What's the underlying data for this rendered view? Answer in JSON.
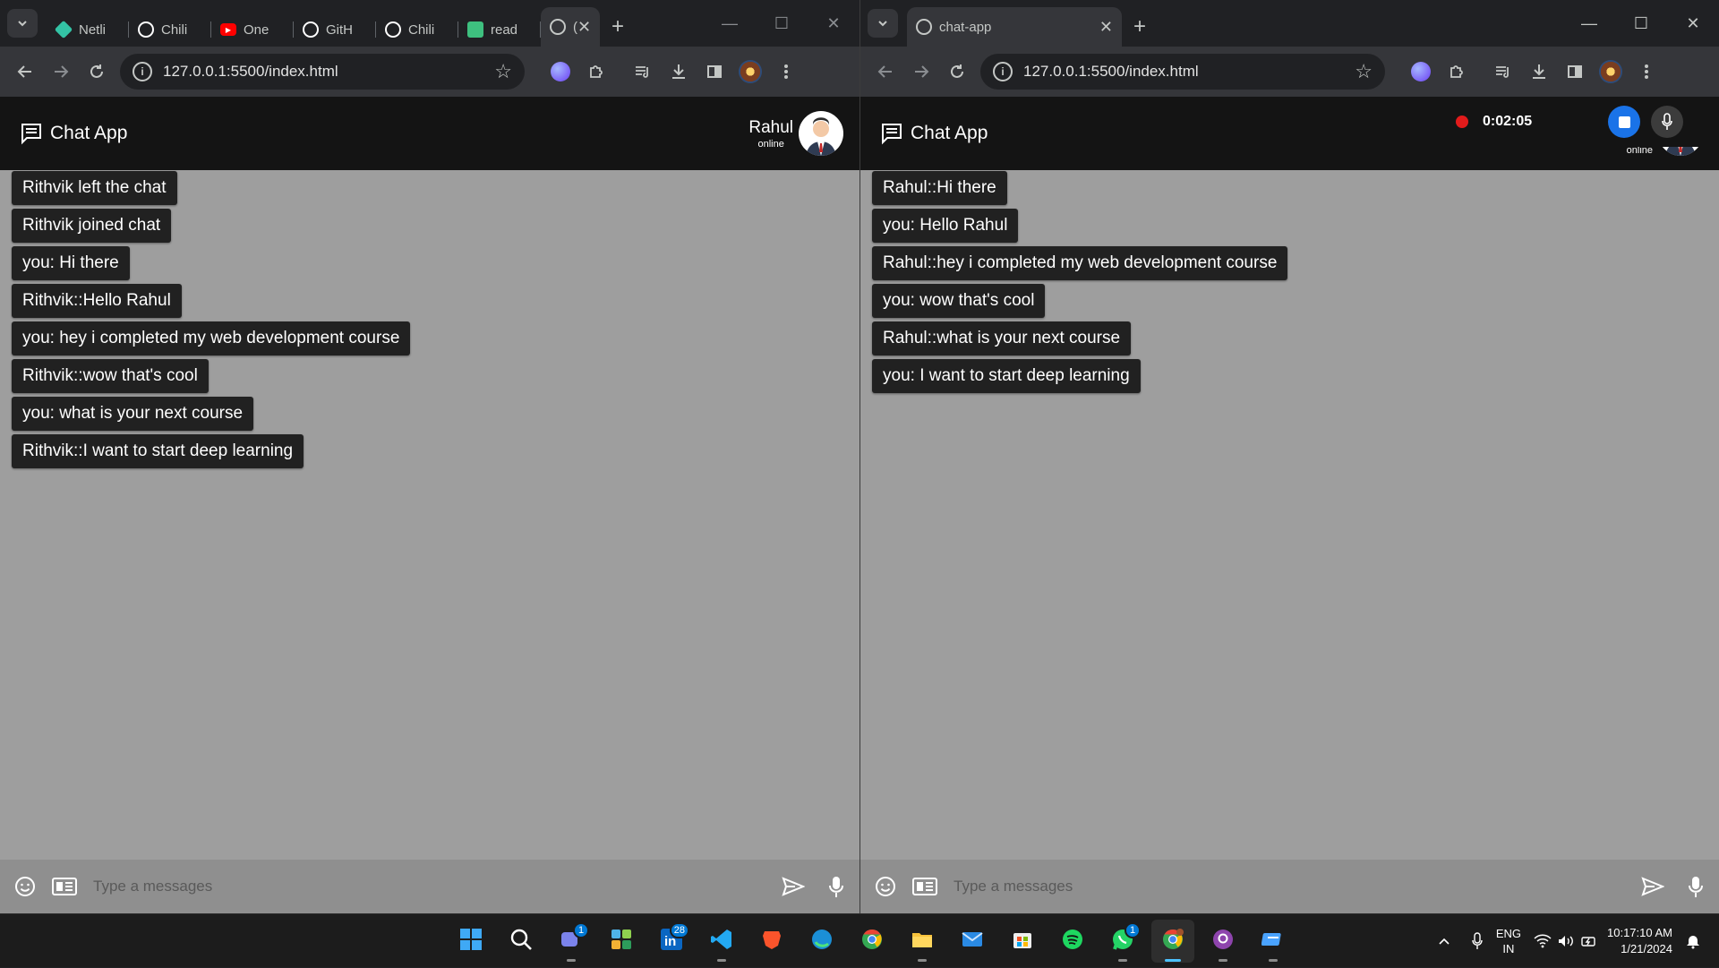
{
  "left": {
    "tabs": [
      {
        "label": "Netli",
        "icon": "netlify-icon",
        "color": "#33c3a5"
      },
      {
        "label": "Chili",
        "icon": "github-icon",
        "color": "#ffffff"
      },
      {
        "label": "One",
        "icon": "youtube-icon",
        "color": "#ff0000"
      },
      {
        "label": "GitH",
        "icon": "github-icon",
        "color": "#ffffff"
      },
      {
        "label": "Chili",
        "icon": "github-icon",
        "color": "#ffffff"
      },
      {
        "label": "read",
        "icon": "readme-icon",
        "color": "#3ec07f"
      },
      {
        "label": "(",
        "icon": "globe-icon",
        "color": "#c4c7c5",
        "active": true
      }
    ],
    "url": "127.0.0.1:5500/index.html",
    "app_title": "Chat App",
    "user_name": "Rahul",
    "user_status": "online",
    "messages": [
      "Rithvik left the chat",
      "Rithvik joined chat",
      "you: Hi there",
      "Rithvik::Hello Rahul",
      "you: hey i completed my web development course",
      "Rithvik::wow that's cool",
      "you: what is your next course",
      "Rithvik::I want to start deep learning"
    ],
    "placeholder": "Type a messages"
  },
  "right": {
    "tabs": [
      {
        "label": "chat-app",
        "icon": "globe-icon",
        "color": "#c4c7c5",
        "active": true
      }
    ],
    "url": "127.0.0.1:5500/index.html",
    "app_title": "Chat App",
    "user_status": "online",
    "recorder_time": "0:02:05",
    "messages": [
      "Rahul::Hi there",
      "you: Hello Rahul",
      "Rahul::hey i completed my web development course",
      "you: wow that's cool",
      "Rahul::what is your next course",
      "you: I want to start deep learning"
    ],
    "placeholder": "Type a messages"
  },
  "taskbar": {
    "apps": [
      {
        "name": "windows-start-icon",
        "badge": ""
      },
      {
        "name": "search-icon",
        "badge": ""
      },
      {
        "name": "teams-icon",
        "badge": "1"
      },
      {
        "name": "widgets-icon",
        "badge": ""
      },
      {
        "name": "linkedin-icon",
        "badge": "28"
      },
      {
        "name": "vscode-icon",
        "badge": ""
      },
      {
        "name": "brave-icon",
        "badge": ""
      },
      {
        "name": "edge-icon",
        "badge": ""
      },
      {
        "name": "chrome-icon",
        "badge": ""
      },
      {
        "name": "file-explorer-icon",
        "badge": ""
      },
      {
        "name": "mail-icon",
        "badge": ""
      },
      {
        "name": "ms-store-icon",
        "badge": ""
      },
      {
        "name": "spotify-icon",
        "badge": ""
      },
      {
        "name": "whatsapp-icon",
        "badge": "1"
      },
      {
        "name": "chrome-profile-icon",
        "badge": ""
      },
      {
        "name": "github-desktop-icon",
        "badge": ""
      },
      {
        "name": "app-icon",
        "badge": ""
      }
    ],
    "lang_top": "ENG",
    "lang_bottom": "IN",
    "time": "10:17:10 AM",
    "date": "1/21/2024"
  },
  "colors": {
    "chat_bg": "#9e9e9e",
    "header_bg": "#141414",
    "bubble_bg": "#212121",
    "composer_bg": "#8f8f8f",
    "recorder_dot": "#e21b1b",
    "recorder_stop": "#1a73e8"
  }
}
